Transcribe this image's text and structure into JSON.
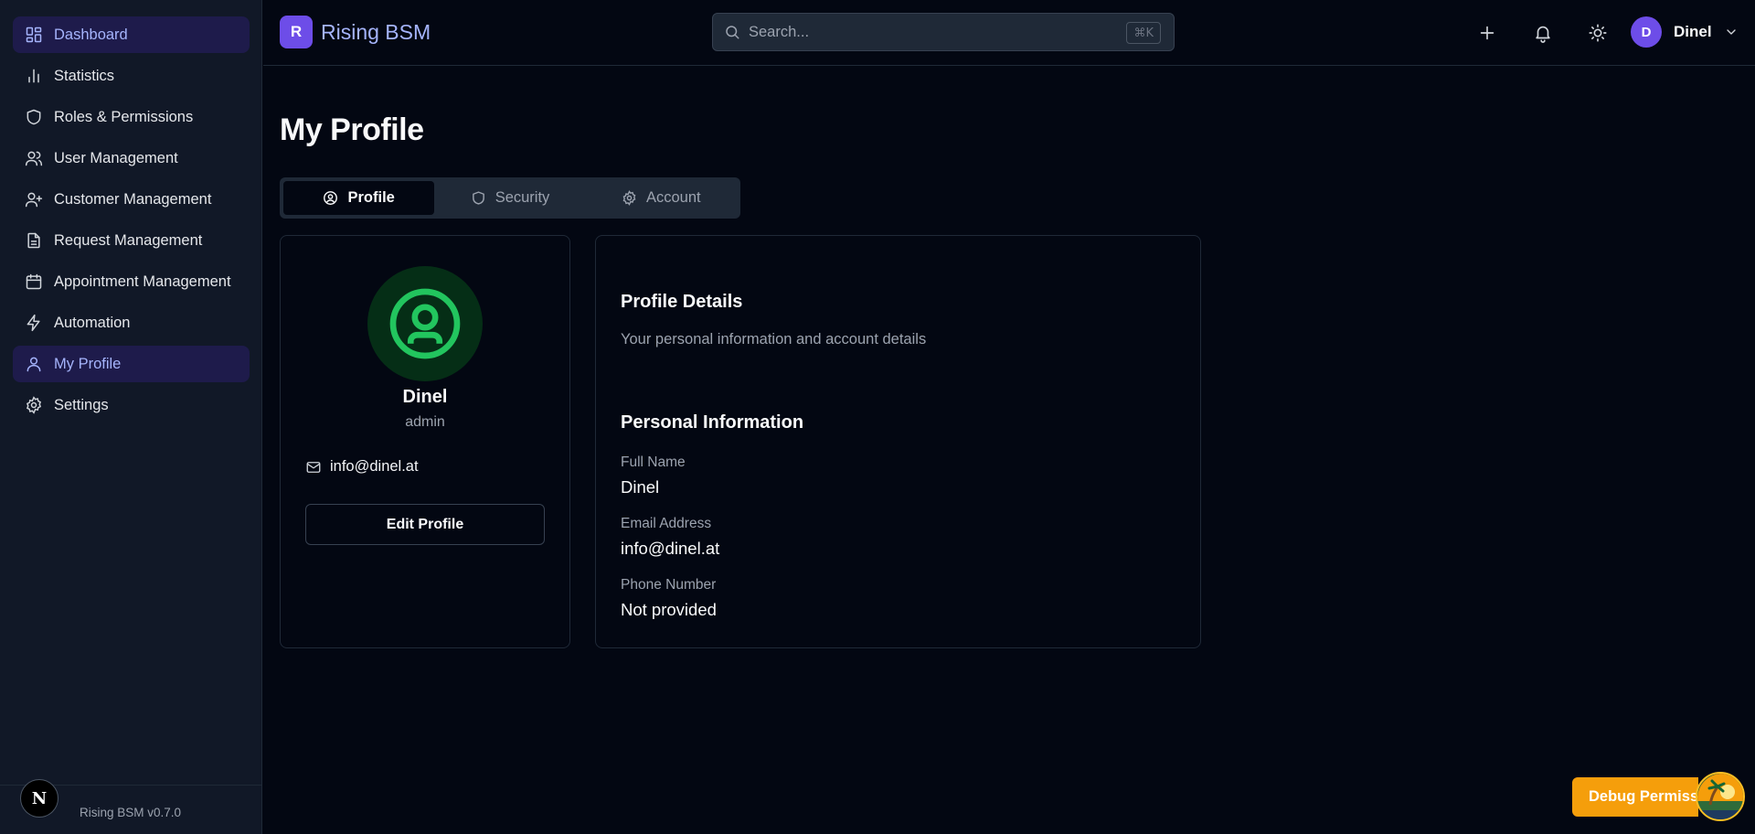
{
  "sidebar": {
    "items": [
      {
        "label": "Dashboard",
        "icon": "dashboard-icon"
      },
      {
        "label": "Statistics",
        "icon": "chart-bars-icon"
      },
      {
        "label": "Roles & Permissions",
        "icon": "shield-icon"
      },
      {
        "label": "User Management",
        "icon": "users-icon"
      },
      {
        "label": "Customer Management",
        "icon": "user-plus-icon"
      },
      {
        "label": "Request Management",
        "icon": "document-icon"
      },
      {
        "label": "Appointment Management",
        "icon": "calendar-icon"
      },
      {
        "label": "Automation",
        "icon": "lightning-icon"
      },
      {
        "label": "My Profile",
        "icon": "user-icon"
      },
      {
        "label": "Settings",
        "icon": "gear-icon"
      }
    ],
    "active_item": "My Profile",
    "footer": {
      "logo_letter": "N",
      "version": "Rising BSM v0.7.0"
    }
  },
  "header": {
    "brand_initial": "R",
    "brand_name": "Rising BSM",
    "search": {
      "placeholder": "Search...",
      "shortcut": "⌘K"
    },
    "user": {
      "initial": "D",
      "name": "Dinel"
    }
  },
  "main": {
    "title": "My Profile",
    "tabs": [
      {
        "label": "Profile",
        "icon": "user-circle-icon",
        "active": true
      },
      {
        "label": "Security",
        "icon": "shield-icon",
        "active": false
      },
      {
        "label": "Account",
        "icon": "gear-icon",
        "active": false
      }
    ],
    "profile_card": {
      "name": "Dinel",
      "role": "admin",
      "email": "info@dinel.at",
      "edit_button": "Edit Profile"
    },
    "details_card": {
      "title": "Profile Details",
      "description": "Your personal information and account details",
      "section_title": "Personal Information",
      "fields": [
        {
          "label": "Full Name",
          "value": "Dinel"
        },
        {
          "label": "Email Address",
          "value": "info@dinel.at"
        },
        {
          "label": "Phone Number",
          "value": "Not provided"
        }
      ]
    }
  },
  "debug": {
    "label": "Debug Permissions"
  },
  "colors": {
    "background": "#030712",
    "sidebar": "#111827",
    "accent": "#6d4de8",
    "accent_text": "#a5b4fc",
    "avatar_green": "#22c55e",
    "debug_orange": "#f59e0b"
  }
}
